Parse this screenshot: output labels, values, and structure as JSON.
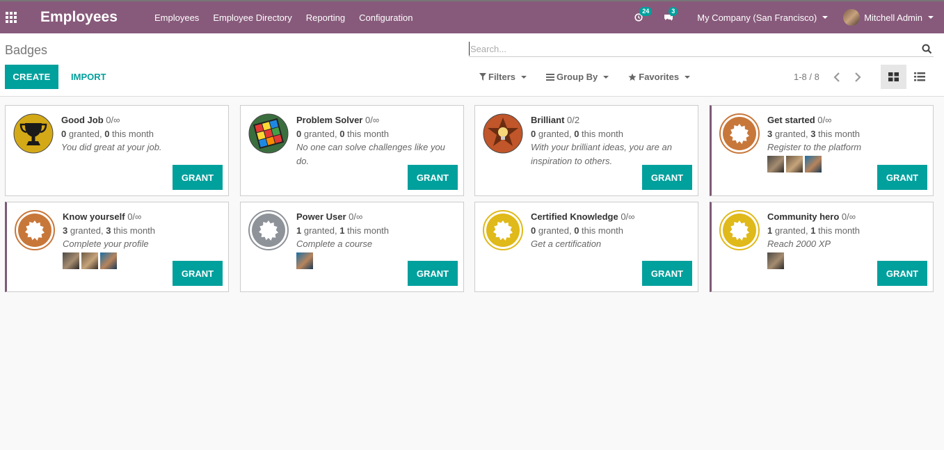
{
  "navbar": {
    "app_title": "Employees",
    "menu": [
      "Employees",
      "Employee Directory",
      "Reporting",
      "Configuration"
    ],
    "activity_count": "24",
    "message_count": "3",
    "company": "My Company (San Francisco)",
    "user": "Mitchell Admin"
  },
  "control_panel": {
    "breadcrumb": "Badges",
    "search_placeholder": "Search...",
    "create_label": "CREATE",
    "import_label": "IMPORT",
    "filters_label": "Filters",
    "groupby_label": "Group By",
    "favorites_label": "Favorites",
    "pager": "1-8 / 8"
  },
  "grant_label": "GRANT",
  "badges": [
    {
      "name": "Good Job",
      "limit": "0/∞",
      "granted": "0",
      "month": "0",
      "desc": "You did great at your job.",
      "icon": "trophy-icon"
    },
    {
      "name": "Problem Solver",
      "limit": "0/∞",
      "granted": "0",
      "month": "0",
      "desc": "No one can solve challenges like you do.",
      "icon": "rubiks-cube-icon"
    },
    {
      "name": "Brilliant",
      "limit": "0/2",
      "granted": "0",
      "month": "0",
      "desc": "With your brilliant ideas, you are an inspiration to others.",
      "icon": "lightbulb-star-icon"
    },
    {
      "name": "Get started",
      "limit": "0/∞",
      "granted": "3",
      "month": "3",
      "desc": "Register to the platform",
      "icon": "bronze-badge-icon",
      "owners": 3
    },
    {
      "name": "Know yourself",
      "limit": "0/∞",
      "granted": "3",
      "month": "3",
      "desc": "Complete your profile",
      "icon": "bronze-badge-icon",
      "owners": 3
    },
    {
      "name": "Power User",
      "limit": "0/∞",
      "granted": "1",
      "month": "1",
      "desc": "Complete a course",
      "icon": "silver-badge-icon",
      "owners": 1
    },
    {
      "name": "Certified Knowledge",
      "limit": "0/∞",
      "granted": "0",
      "month": "0",
      "desc": "Get a certification",
      "icon": "gold-badge-icon"
    },
    {
      "name": "Community hero",
      "limit": "0/∞",
      "granted": "1",
      "month": "1",
      "desc": "Reach 2000 XP",
      "icon": "gold-badge-icon",
      "owners": 1
    }
  ],
  "label_granted": "granted,",
  "label_month": "this month",
  "colors": {
    "primary": "#875a7b",
    "accent": "#00a09d",
    "bronze": "#c8773a",
    "silver": "#8e9299",
    "gold": "#e0b91a"
  }
}
